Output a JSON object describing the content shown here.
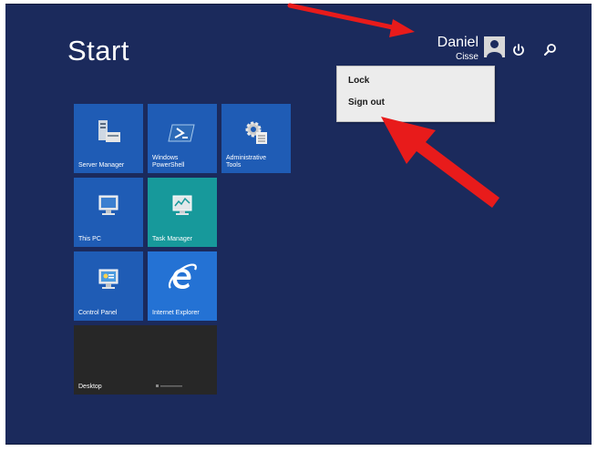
{
  "start_screen": {
    "title": "Start"
  },
  "user": {
    "first_name": "Daniel",
    "last_name": "Cisse"
  },
  "user_menu": {
    "items": [
      {
        "label": "Lock"
      },
      {
        "label": "Sign out"
      }
    ]
  },
  "tiles": [
    {
      "label": "Server Manager",
      "color": "#1f5cb5",
      "icon": "server-manager-icon"
    },
    {
      "label": "Windows\nPowerShell",
      "color": "#1f5cb5",
      "icon": "powershell-icon"
    },
    {
      "label": "Administrative\nTools",
      "color": "#1f5cb5",
      "icon": "admin-tools-icon"
    },
    {
      "label": "This PC",
      "color": "#1f5cb5",
      "icon": "computer-icon"
    },
    {
      "label": "Task Manager",
      "color": "#17999b",
      "icon": "task-manager-icon"
    },
    {
      "label": "Control Panel",
      "color": "#1f5cb5",
      "icon": "control-panel-icon"
    },
    {
      "label": "Internet Explorer",
      "color": "#2472d4",
      "icon": "internet-explorer-icon"
    },
    {
      "label": "Desktop",
      "color": "#272727",
      "icon": "desktop-wallpaper-icon"
    }
  ],
  "colors": {
    "background": "#1b2a5c",
    "annotation_arrow": "#e81b1b"
  }
}
